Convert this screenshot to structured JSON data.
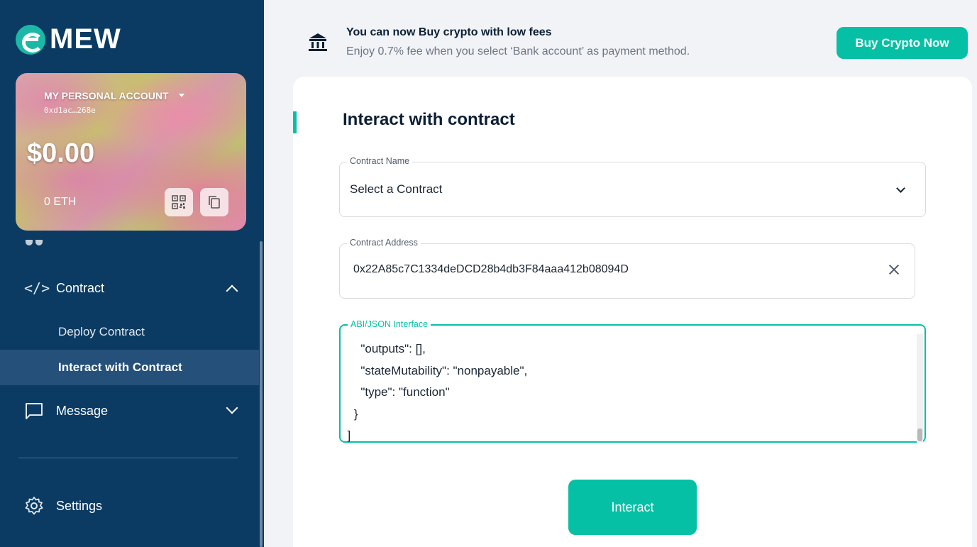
{
  "brand": {
    "logo_text": "MEW"
  },
  "account": {
    "name": "MY PERSONAL ACCOUNT",
    "address_short": "0xd1ac…268e",
    "balance_usd": "$0.00",
    "balance_eth": "0 ETH"
  },
  "sidebar": {
    "contract": {
      "label": "Contract",
      "icon": "code-icon"
    },
    "sub_items": [
      "Deploy Contract",
      "Interact with Contract"
    ],
    "message": {
      "label": "Message",
      "icon": "chat-icon"
    },
    "settings": {
      "label": "Settings",
      "icon": "gear-icon"
    }
  },
  "banner": {
    "title": "You can now Buy crypto with low fees",
    "subtitle": "Enjoy 0.7% fee when you select ‘Bank account’ as payment method.",
    "button": "Buy Crypto Now"
  },
  "main": {
    "title": "Interact with contract",
    "contract_name": {
      "label": "Contract Name",
      "value": "Select a Contract"
    },
    "contract_address": {
      "label": "Contract Address",
      "value": "0x22A85c7C1334deDCD28b4db3F84aaa412b08094D"
    },
    "abi": {
      "label": "ABI/JSON Interface",
      "text": "      \"outputs\": [],\n      \"stateMutability\": \"nonpayable\",\n      \"type\": \"function\"\n    }\n  ]"
    },
    "interact_button": "Interact"
  },
  "colors": {
    "sidebar": "#0b3b63",
    "accent": "#05c0a5",
    "background": "#f2f3f6"
  }
}
